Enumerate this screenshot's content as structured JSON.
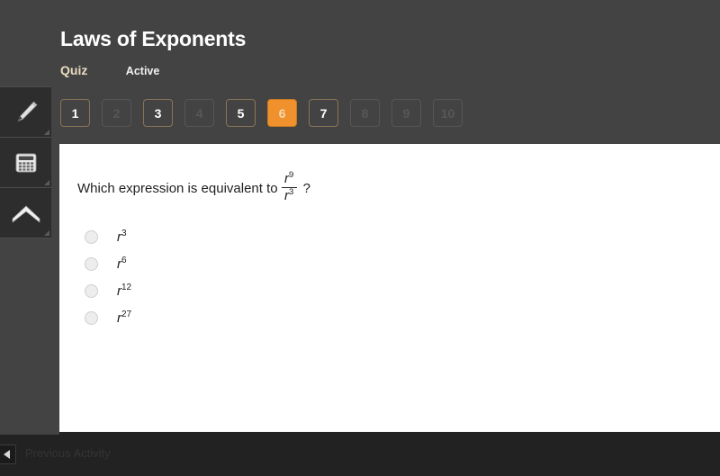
{
  "header": {
    "title": "Laws of Exponents",
    "kind": "Quiz",
    "status": "Active"
  },
  "question_nav": {
    "buttons": [
      {
        "label": "1",
        "state": "available"
      },
      {
        "label": "2",
        "state": "disabled"
      },
      {
        "label": "3",
        "state": "available"
      },
      {
        "label": "4",
        "state": "disabled"
      },
      {
        "label": "5",
        "state": "available"
      },
      {
        "label": "6",
        "state": "current"
      },
      {
        "label": "7",
        "state": "available"
      },
      {
        "label": "8",
        "state": "disabled"
      },
      {
        "label": "9",
        "state": "disabled"
      },
      {
        "label": "10",
        "state": "disabled"
      }
    ]
  },
  "toolrail": {
    "tools": [
      {
        "icon": "marker-icon"
      },
      {
        "icon": "calculator-icon"
      },
      {
        "icon": "up-arrow-icon"
      }
    ]
  },
  "question": {
    "prompt": "Which expression is equivalent to",
    "fraction": {
      "numerator_base": "r",
      "numerator_exp": "9",
      "denominator_base": "r",
      "denominator_exp": "3"
    },
    "terminator": "?",
    "options": [
      {
        "base": "r",
        "exponent": "3",
        "selected": false
      },
      {
        "base": "r",
        "exponent": "6",
        "selected": false
      },
      {
        "base": "r",
        "exponent": "12",
        "selected": false
      },
      {
        "base": "r",
        "exponent": "27",
        "selected": false
      }
    ]
  },
  "bottombar": {
    "previous_label": "Previous Activity"
  },
  "colors": {
    "header_bg": "#434343",
    "accent_orange": "#f0912d",
    "available_border": "#8a7458",
    "kind_text": "#e8dcc0",
    "panel_bg": "#ffffff",
    "bottom_bg": "#222222"
  }
}
